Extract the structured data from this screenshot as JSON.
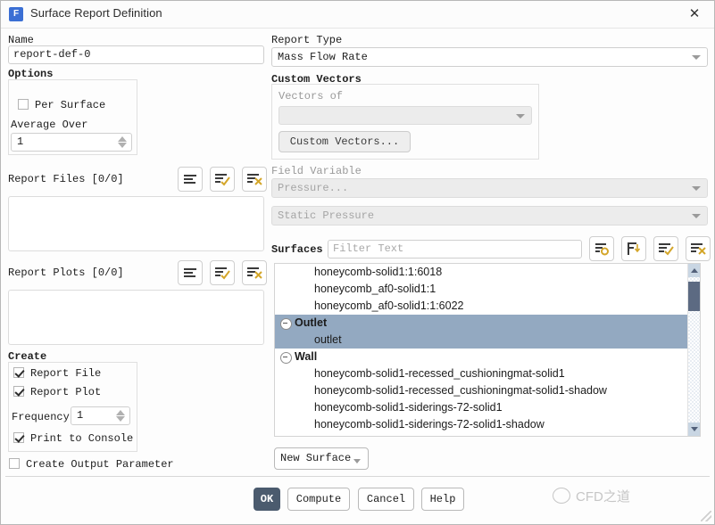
{
  "window": {
    "title": "Surface Report Definition",
    "app_icon": "F",
    "close_icon": "✕"
  },
  "left": {
    "name_label": "Name",
    "name_value": "report-def-0",
    "options_label": "Options",
    "per_surface_label": "Per Surface",
    "per_surface_checked": false,
    "average_over_label": "Average Over",
    "average_over_value": "1",
    "report_files_label": "Report Files [0/0]",
    "report_plots_label": "Report Plots [0/0]",
    "create_label": "Create",
    "report_file_label": "Report File",
    "report_file_checked": true,
    "report_plot_label": "Report Plot",
    "report_plot_checked": true,
    "frequency_label": "Frequency",
    "frequency_value": "1",
    "print_to_console_label": "Print to Console",
    "print_to_console_checked": true,
    "create_output_parameter_label": "Create Output Parameter",
    "create_output_parameter_checked": false
  },
  "right": {
    "report_type_label": "Report Type",
    "report_type_value": "Mass Flow Rate",
    "custom_vectors_label": "Custom Vectors",
    "vectors_of_label": "Vectors of",
    "vectors_of_value": "",
    "custom_vectors_button": "Custom Vectors...",
    "field_variable_label": "Field Variable",
    "field_variable_value": "Pressure...",
    "field_variable_sub_value": "Static Pressure",
    "surfaces_label": "Surfaces",
    "surfaces_filter_placeholder": "Filter Text",
    "surfaces_filter_value": ""
  },
  "surfaces_tree": [
    {
      "type": "leaf",
      "label": "honeycomb-solid1:1:6018",
      "selected": false
    },
    {
      "type": "leaf",
      "label": "honeycomb_af0-solid1:1",
      "selected": false
    },
    {
      "type": "leaf",
      "label": "honeycomb_af0-solid1:1:6022",
      "selected": false
    },
    {
      "type": "group",
      "label": "Outlet",
      "selected": true,
      "expanded": true
    },
    {
      "type": "leaf",
      "label": "outlet",
      "selected": true
    },
    {
      "type": "group",
      "label": "Wall",
      "selected": false,
      "expanded": true
    },
    {
      "type": "leaf",
      "label": "honeycomb-solid1-recessed_cushioningmat-solid1",
      "selected": false
    },
    {
      "type": "leaf",
      "label": "honeycomb-solid1-recessed_cushioningmat-solid1-shadow",
      "selected": false
    },
    {
      "type": "leaf",
      "label": "honeycomb-solid1-siderings-72-solid1",
      "selected": false
    },
    {
      "type": "leaf",
      "label": "honeycomb-solid1-siderings-72-solid1-shadow",
      "selected": false
    }
  ],
  "buttons": {
    "new_surface": "New Surface",
    "ok": "OK",
    "compute": "Compute",
    "cancel": "Cancel",
    "help": "Help"
  },
  "watermark": {
    "text": "CFD之道"
  },
  "icons": {
    "list_all": "list-all-icon",
    "list_check": "list-check-icon",
    "list_clear": "list-clear-icon",
    "list_circle": "list-circle-icon",
    "list_filter": "list-filter-icon"
  },
  "colors": {
    "selection": "#93a9c1",
    "primary_button": "#4b5b6e",
    "accent_check": "#d4a62a",
    "app_icon": "#3b6fd4"
  }
}
